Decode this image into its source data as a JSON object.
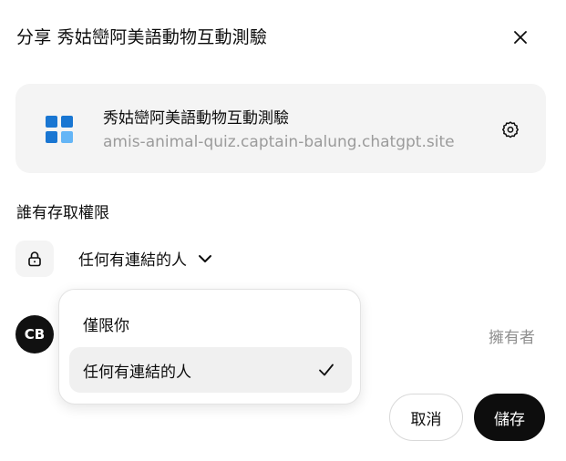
{
  "dialog": {
    "title": "分享 秀姑巒阿美語動物互動測驗",
    "close_icon": "close-icon"
  },
  "app_card": {
    "name": "秀姑巒阿美語動物互動測驗",
    "url": "amis-animal-quiz.captain-balung.chatgpt.site",
    "icon": "app-grid-icon",
    "icon_colors": [
      "#1976d2",
      "#64b5f6"
    ],
    "settings_icon": "gear-icon"
  },
  "access": {
    "label": "誰有存取權限",
    "lock_icon": "lock-icon",
    "selected": "任何有連結的人",
    "chevron_icon": "chevron-down-icon"
  },
  "dropdown": {
    "options": [
      {
        "label": "僅限你",
        "selected": false
      },
      {
        "label": "任何有連結的人",
        "selected": true
      }
    ],
    "check_icon": "check-icon"
  },
  "owner": {
    "initials": "CB",
    "role": "擁有者"
  },
  "footer": {
    "cancel_label": "取消",
    "save_label": "儲存"
  }
}
